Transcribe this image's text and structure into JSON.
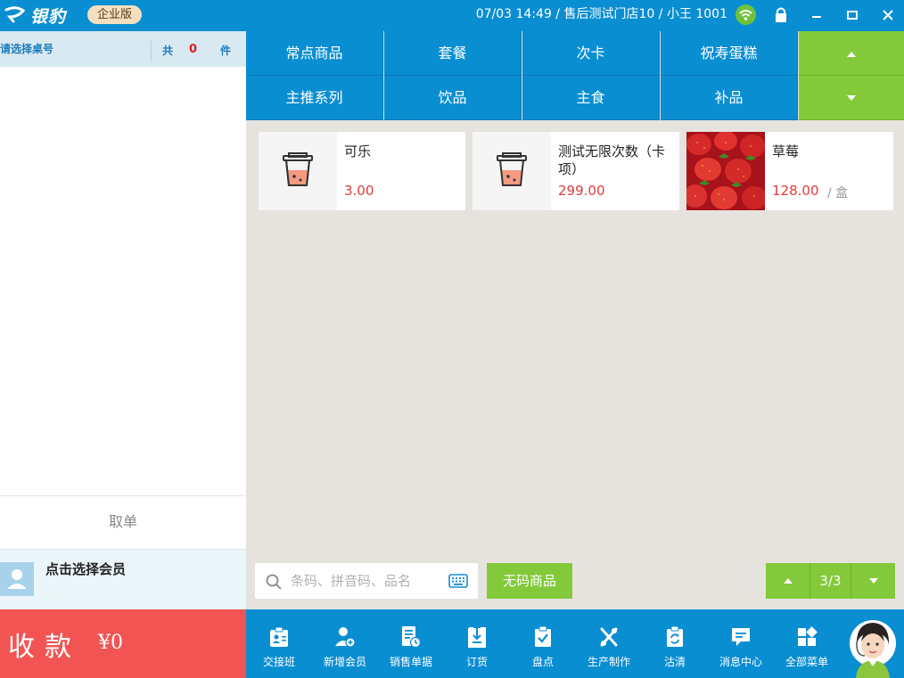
{
  "titlebar": {
    "logo_text": "银豹",
    "edition": "企业版",
    "status": "07/03 14:49 / 售后测试门店10 / 小王 1001",
    "icons": [
      "wifi-icon",
      "lock-icon",
      "minimize-icon",
      "maximize-icon",
      "close-icon"
    ]
  },
  "order_panel": {
    "table_label": "请选择桌号",
    "count_prefix": "共",
    "count_value": "0",
    "count_unit": "件",
    "cancel_label": "取单",
    "member_label": "点击选择会员",
    "pay_label": "收款",
    "pay_amount": "¥0"
  },
  "categories": [
    {
      "label": "常点商品"
    },
    {
      "label": "套餐"
    },
    {
      "label": "次卡"
    },
    {
      "label": "祝寿蛋糕"
    },
    {
      "label": "主推系列"
    },
    {
      "label": "饮品"
    },
    {
      "label": "主食"
    },
    {
      "label": "补品"
    }
  ],
  "products": [
    {
      "name": "可乐",
      "price": "3.00",
      "unit": "",
      "image": "drink-icon"
    },
    {
      "name": "测试无限次数（卡项）",
      "price": "299.00",
      "unit": "",
      "image": "drink-icon"
    },
    {
      "name": "草莓",
      "price": "128.00",
      "unit": "/ 盒",
      "image": "strawberry-photo"
    }
  ],
  "search": {
    "placeholder": "条码、拼音码、品名",
    "value": ""
  },
  "no_code_label": "无码商品",
  "pager": {
    "text": "3/3"
  },
  "toolbar": [
    {
      "label": "交接班",
      "icon": "shift-handover-icon"
    },
    {
      "label": "新增会员",
      "icon": "add-member-icon"
    },
    {
      "label": "销售单据",
      "icon": "sales-receipt-icon"
    },
    {
      "label": "订货",
      "icon": "order-goods-icon"
    },
    {
      "label": "盘点",
      "icon": "inventory-check-icon"
    },
    {
      "label": "生产制作",
      "icon": "production-icon"
    },
    {
      "label": "沽清",
      "icon": "sold-out-icon"
    },
    {
      "label": "消息中心",
      "icon": "message-icon"
    },
    {
      "label": "全部菜单",
      "icon": "all-menu-icon"
    }
  ],
  "colors": {
    "primary_blue": "#0a8ed2",
    "accent_green": "#83c93a",
    "pay_red": "#f25454",
    "price_red": "#e03b3b"
  }
}
